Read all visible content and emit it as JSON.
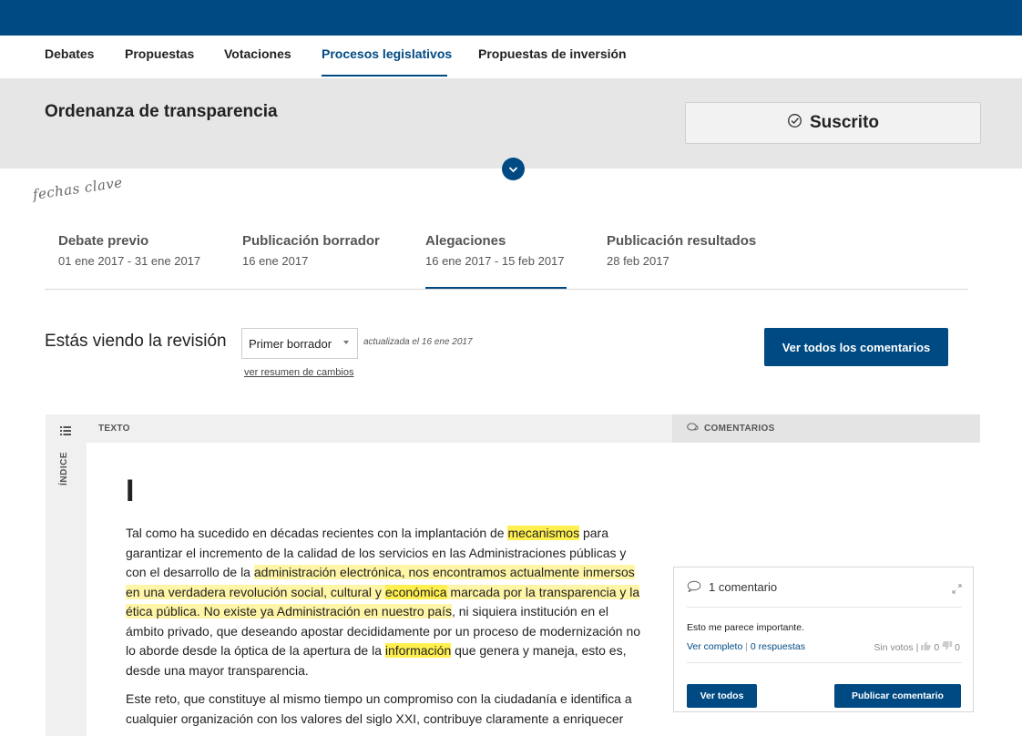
{
  "nav": {
    "items": [
      {
        "label": "Debates"
      },
      {
        "label": "Propuestas"
      },
      {
        "label": "Votaciones"
      },
      {
        "label": "Procesos legislativos",
        "active": true
      },
      {
        "label": "Propuestas de inversión"
      }
    ]
  },
  "process": {
    "title": "Ordenanza de transparencia",
    "subscribe_label": "Suscrito"
  },
  "key_dates": {
    "title": "fechas clave",
    "phases": [
      {
        "name": "Debate previo",
        "dates": "01 ene 2017 - 31 ene 2017"
      },
      {
        "name": "Publicación borrador",
        "dates": "16 ene 2017"
      },
      {
        "name": "Alegaciones",
        "dates": "16 ene 2017 - 15 feb 2017",
        "active": true
      },
      {
        "name": "Publicación resultados",
        "dates": "28 feb 2017"
      }
    ]
  },
  "revision": {
    "label": "Estás viendo la revisión",
    "selected": "Primer borrador",
    "updated": "actualizada el 16 ene 2017",
    "changes_link": "ver resumen de cambios",
    "all_comments_button": "Ver todos los comentarios"
  },
  "content": {
    "header_text": "TEXTO",
    "header_comments": "COMENTARIOS",
    "index_label": "ÍNDICE",
    "section_heading": "I",
    "p1": {
      "t1": "Tal como ha sucedido en décadas recientes con la implantación de ",
      "h1": "mecanismos",
      "t2": " para garantizar el incremento de la calidad de los servicios en las Administraciones públicas y con el desarrollo de la ",
      "h2": "administración electrónica, nos encontramos actualmente inmersos en una verdadera revolución social, cultural y ",
      "h3": "económica",
      "h4": " marcada por la transparencia y la ética pública. No existe ya Administración en nuestro país",
      "t3": ", ni siquiera institución en el ámbito privado, que deseando apostar decididamente por un proceso de modernización no lo aborde desde la óptica de la apertura de la ",
      "h5": "información",
      "t4": " que genera y maneja, esto es, desde una mayor transparencia."
    },
    "p2": "Este reto, que constituye al mismo tiempo un compromiso con la ciudadanía e identifica a cualquier organización con los valores del siglo XXI, contribuye claramente a enriquecer"
  },
  "comment": {
    "count_label": "1 comentario",
    "body": "Esto me parece importante.",
    "view_full": "Ver completo",
    "separator": "|",
    "replies": "0 respuestas",
    "votes_label": "Sin votos",
    "votes_separator": "|",
    "likes": "0",
    "dislikes": "0",
    "view_all_button": "Ver todos",
    "publish_button": "Publicar comentario"
  },
  "colors": {
    "brand": "#004a83",
    "highlight_light": "#fff5a6",
    "highlight_strong": "#fff04f"
  }
}
